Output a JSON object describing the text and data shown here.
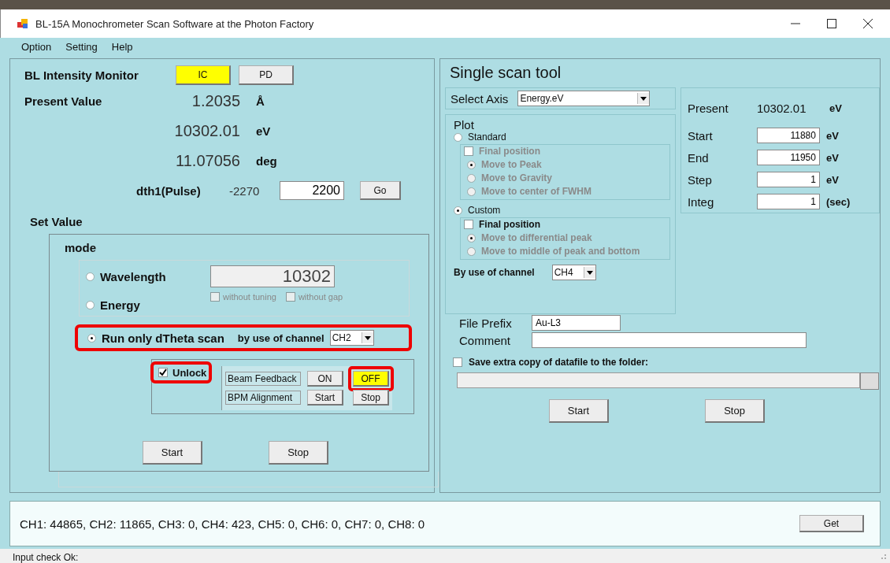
{
  "window": {
    "title": "BL-15A Monochrometer Scan Software at the Photon Factory"
  },
  "menu": [
    {
      "label": "Option"
    },
    {
      "label": "Setting"
    },
    {
      "label": "Help"
    }
  ],
  "monitor": {
    "label": "BL Intensity Monitor",
    "buttons": [
      {
        "label": "IC",
        "selected": true
      },
      {
        "label": "PD",
        "selected": false
      }
    ]
  },
  "present": {
    "label": "Present Value",
    "values": [
      {
        "value": "1.2035",
        "unit": "Å"
      },
      {
        "value": "10302.01",
        "unit": "eV"
      },
      {
        "value": "11.07056",
        "unit": "deg"
      }
    ]
  },
  "dth1": {
    "label": "dth1(Pulse)",
    "reading": "-2270",
    "value": "2200",
    "button": "Go"
  },
  "set_value": {
    "label": "Set Value"
  },
  "mode": {
    "title": "mode",
    "options": [
      {
        "label": "Wavelength",
        "selected": false
      },
      {
        "label": "Energy",
        "selected": false
      }
    ],
    "value": "10302",
    "value_disabled": true,
    "checks": [
      {
        "label": "without tuning",
        "checked": false
      },
      {
        "label": "without gap",
        "checked": false
      }
    ],
    "dtheta": {
      "label": "Run only dTheta scan",
      "selected": true,
      "highlighted": true,
      "channel_label": "by use of channel",
      "channel": "CH2"
    },
    "unlock": {
      "label": "Unlock",
      "checked": true,
      "highlighted": true
    },
    "controls": [
      {
        "label": "Beam Feedback",
        "buttons": [
          {
            "label": "ON",
            "selected": false,
            "highlighted": false
          },
          {
            "label": "OFF",
            "selected": true,
            "highlighted": true
          }
        ]
      },
      {
        "label": "BPM Alignment",
        "buttons": [
          {
            "label": "Start",
            "selected": false,
            "highlighted": false
          },
          {
            "label": "Stop",
            "selected": false,
            "highlighted": false
          }
        ]
      }
    ],
    "buttons": [
      {
        "label": "Start"
      },
      {
        "label": "Stop"
      }
    ]
  },
  "scan": {
    "title": "Single scan tool",
    "axis_label": "Select Axis",
    "axis": "Energy.eV",
    "plot": {
      "title": "Plot",
      "groups": [
        {
          "label": "Standard",
          "selected": false,
          "final": {
            "label": "Final position",
            "checked": false,
            "disabled": true
          },
          "moves": [
            {
              "label": "Move to Peak",
              "selected": true,
              "disabled": true
            },
            {
              "label": "Move to Gravity",
              "selected": false,
              "disabled": true
            },
            {
              "label": "Move to center of FWHM",
              "selected": false,
              "disabled": true
            }
          ]
        },
        {
          "label": "Custom",
          "selected": true,
          "final": {
            "label": "Final position",
            "checked": false,
            "disabled": false
          },
          "moves": [
            {
              "label": "Move to differential peak",
              "selected": true,
              "disabled": true
            },
            {
              "label": "Move to middle of peak and bottom",
              "selected": false,
              "disabled": true
            }
          ]
        }
      ],
      "channel_label": "By use of channel",
      "channel": "CH4"
    },
    "present": {
      "label": "Present",
      "value": "10302.01",
      "unit": "eV"
    },
    "params": [
      {
        "label": "Start",
        "value": "11880",
        "unit": "eV"
      },
      {
        "label": "End",
        "value": "11950",
        "unit": "eV"
      },
      {
        "label": "Step",
        "value": "1",
        "unit": "eV"
      },
      {
        "label": "Integ",
        "value": "1",
        "unit": "(sec)"
      }
    ],
    "file_prefix": {
      "label": "File Prefix",
      "value": "Au-L3"
    },
    "comment": {
      "label": "Comment"
    },
    "save_copy": {
      "label": "Save extra copy of datafile to the folder:",
      "checked": false
    },
    "buttons": [
      {
        "label": "Start"
      },
      {
        "label": "Stop"
      }
    ]
  },
  "channels": {
    "text": "CH1: 44865, CH2: 11865, CH3: 0, CH4: 423, CH5: 0, CH6: 0, CH7: 0, CH8: 0",
    "button": "Get"
  },
  "status_bar": {
    "text": "Input check Ok:"
  }
}
